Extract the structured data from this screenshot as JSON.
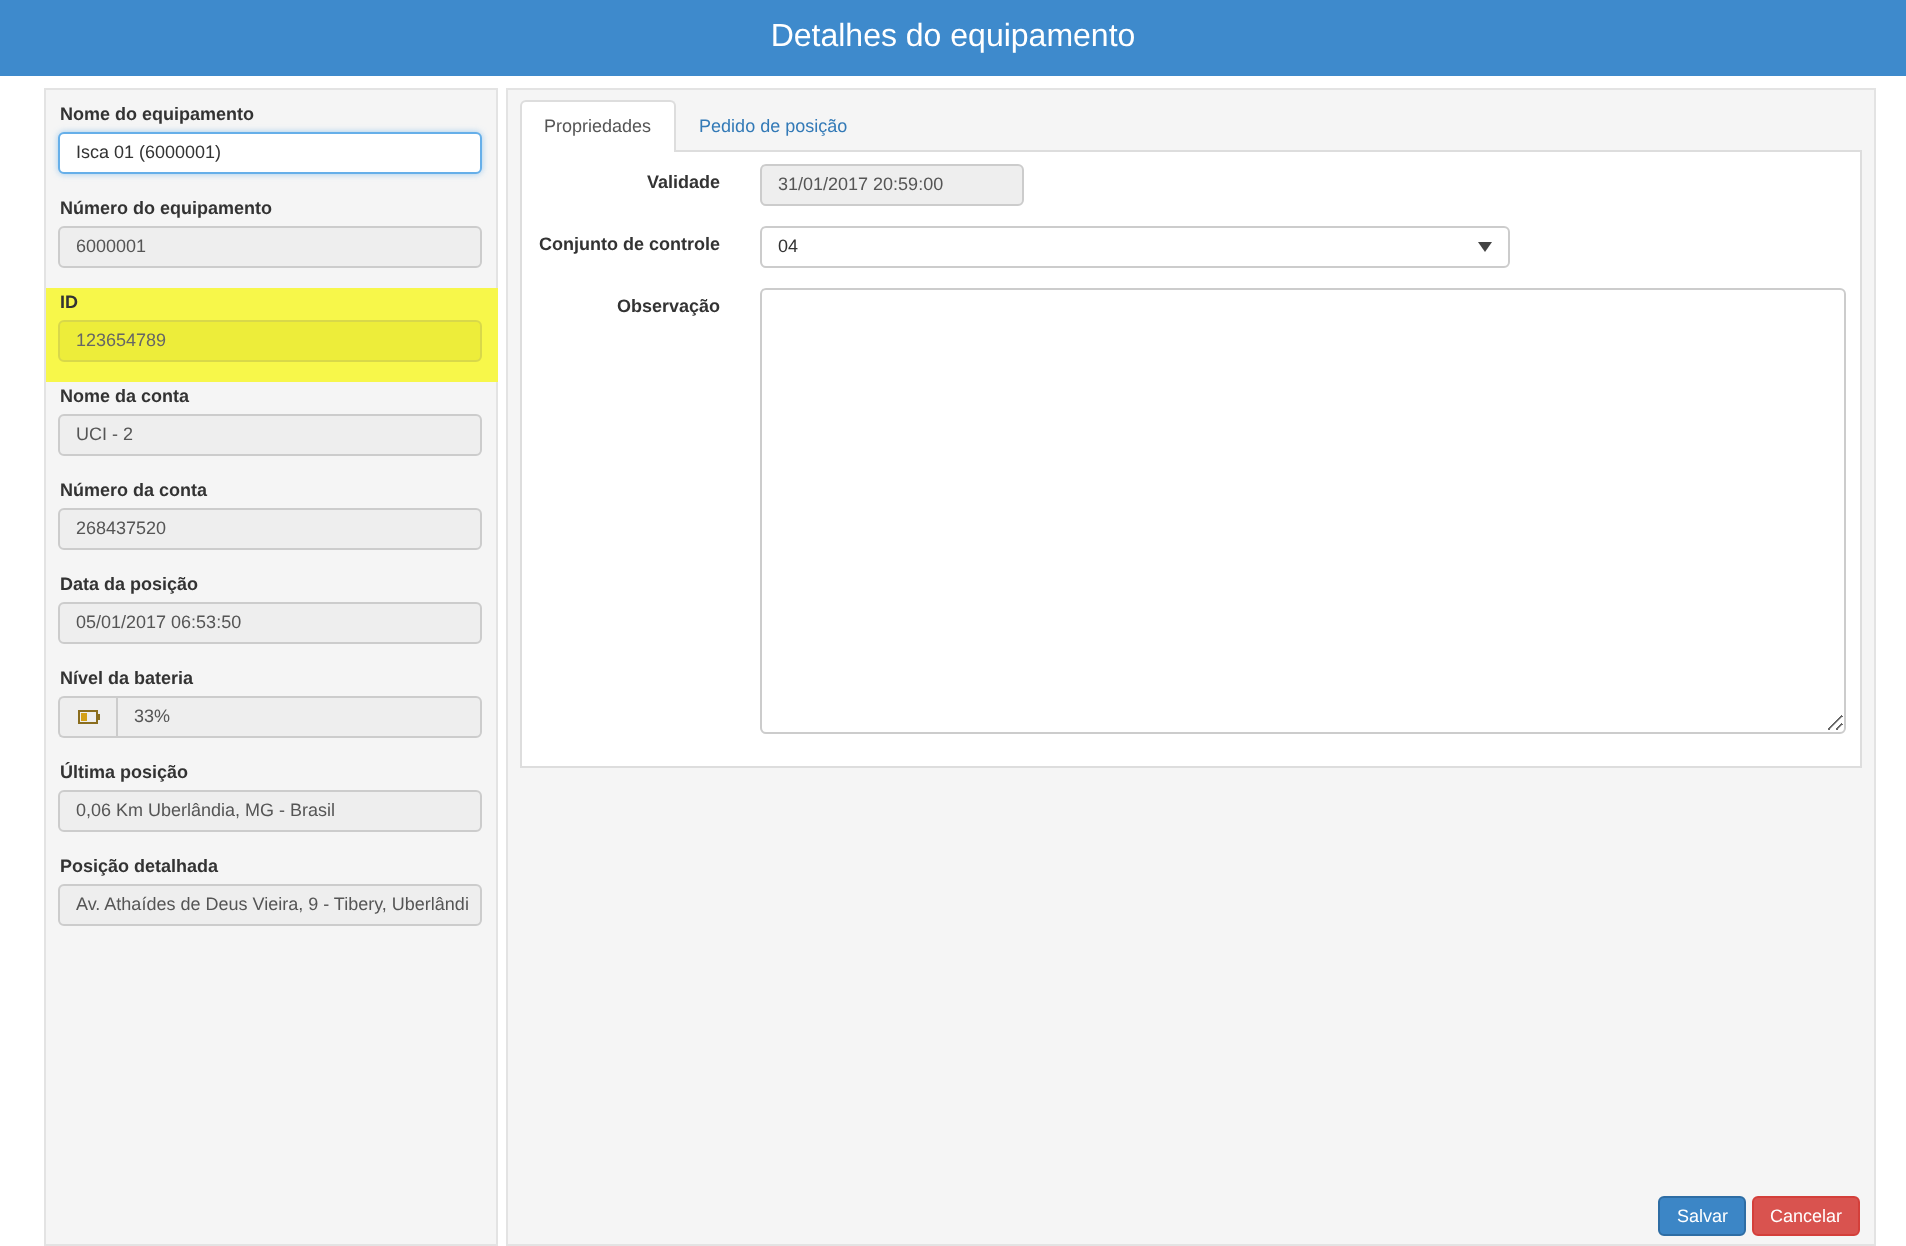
{
  "header": {
    "title": "Detalhes do equipamento"
  },
  "fields": [
    {
      "label": "Nome do equipamento",
      "value": "Isca 01 (6000001)",
      "kind": "input",
      "highlighted": false
    },
    {
      "label": "Número do equipamento",
      "value": "6000001",
      "kind": "readonly",
      "highlighted": false
    },
    {
      "label": "ID",
      "value": "123654789",
      "kind": "readonly",
      "highlighted": true
    },
    {
      "label": "Nome da conta",
      "value": "UCI - 2",
      "kind": "readonly",
      "highlighted": false
    },
    {
      "label": "Número da conta",
      "value": "268437520",
      "kind": "readonly",
      "highlighted": false
    },
    {
      "label": "Data da posição",
      "value": "05/01/2017 06:53:50",
      "kind": "readonly",
      "highlighted": false
    },
    {
      "label": "Nível da bateria",
      "value": "33%",
      "kind": "battery",
      "highlighted": false
    },
    {
      "label": "Última posição",
      "value": "0,06 Km Uberlândia, MG - Brasil",
      "kind": "readonly",
      "highlighted": false
    },
    {
      "label": "Posição detalhada",
      "value": "Av. Athaídes de Deus Vieira, 9 - Tibery, Uberlândi",
      "kind": "readonly",
      "highlighted": false
    }
  ],
  "tabs": [
    {
      "label": "Propriedades",
      "selected": true
    },
    {
      "label": "Pedido de posição",
      "selected": false
    }
  ],
  "properties": [
    {
      "label": "Validade",
      "value": "31/01/2017 20:59:00",
      "kind": "readonly"
    },
    {
      "label": "Conjunto de controle",
      "value": "04",
      "kind": "select"
    },
    {
      "label": "Observação",
      "kind": "textarea"
    }
  ],
  "buttons": [
    {
      "label": "Salvar",
      "kind": "primary"
    },
    {
      "label": "Cancelar",
      "kind": "danger"
    }
  ]
}
